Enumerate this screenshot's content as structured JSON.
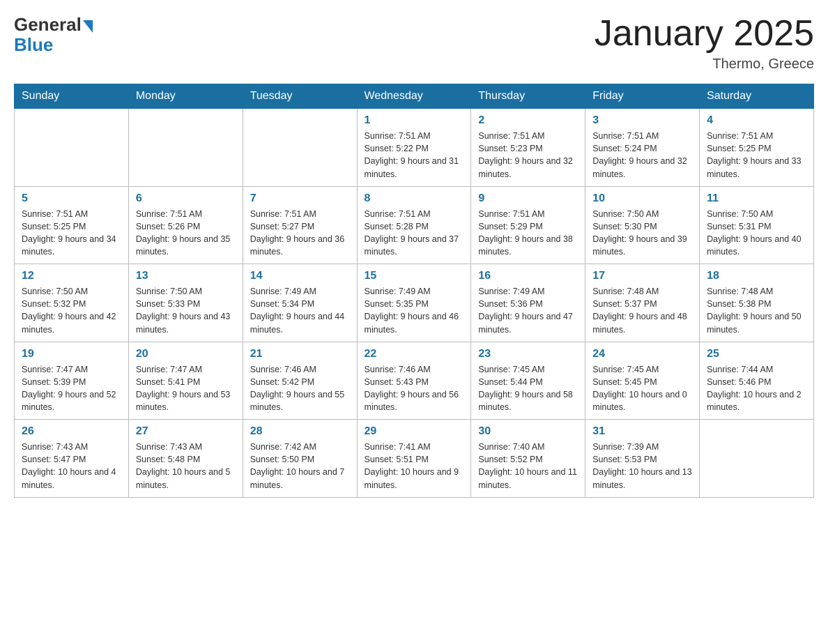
{
  "logo": {
    "general": "General",
    "blue": "Blue"
  },
  "header": {
    "title": "January 2025",
    "location": "Thermo, Greece"
  },
  "weekdays": [
    "Sunday",
    "Monday",
    "Tuesday",
    "Wednesday",
    "Thursday",
    "Friday",
    "Saturday"
  ],
  "weeks": [
    [
      {
        "day": "",
        "sunrise": "",
        "sunset": "",
        "daylight": ""
      },
      {
        "day": "",
        "sunrise": "",
        "sunset": "",
        "daylight": ""
      },
      {
        "day": "",
        "sunrise": "",
        "sunset": "",
        "daylight": ""
      },
      {
        "day": "1",
        "sunrise": "Sunrise: 7:51 AM",
        "sunset": "Sunset: 5:22 PM",
        "daylight": "Daylight: 9 hours and 31 minutes."
      },
      {
        "day": "2",
        "sunrise": "Sunrise: 7:51 AM",
        "sunset": "Sunset: 5:23 PM",
        "daylight": "Daylight: 9 hours and 32 minutes."
      },
      {
        "day": "3",
        "sunrise": "Sunrise: 7:51 AM",
        "sunset": "Sunset: 5:24 PM",
        "daylight": "Daylight: 9 hours and 32 minutes."
      },
      {
        "day": "4",
        "sunrise": "Sunrise: 7:51 AM",
        "sunset": "Sunset: 5:25 PM",
        "daylight": "Daylight: 9 hours and 33 minutes."
      }
    ],
    [
      {
        "day": "5",
        "sunrise": "Sunrise: 7:51 AM",
        "sunset": "Sunset: 5:25 PM",
        "daylight": "Daylight: 9 hours and 34 minutes."
      },
      {
        "day": "6",
        "sunrise": "Sunrise: 7:51 AM",
        "sunset": "Sunset: 5:26 PM",
        "daylight": "Daylight: 9 hours and 35 minutes."
      },
      {
        "day": "7",
        "sunrise": "Sunrise: 7:51 AM",
        "sunset": "Sunset: 5:27 PM",
        "daylight": "Daylight: 9 hours and 36 minutes."
      },
      {
        "day": "8",
        "sunrise": "Sunrise: 7:51 AM",
        "sunset": "Sunset: 5:28 PM",
        "daylight": "Daylight: 9 hours and 37 minutes."
      },
      {
        "day": "9",
        "sunrise": "Sunrise: 7:51 AM",
        "sunset": "Sunset: 5:29 PM",
        "daylight": "Daylight: 9 hours and 38 minutes."
      },
      {
        "day": "10",
        "sunrise": "Sunrise: 7:50 AM",
        "sunset": "Sunset: 5:30 PM",
        "daylight": "Daylight: 9 hours and 39 minutes."
      },
      {
        "day": "11",
        "sunrise": "Sunrise: 7:50 AM",
        "sunset": "Sunset: 5:31 PM",
        "daylight": "Daylight: 9 hours and 40 minutes."
      }
    ],
    [
      {
        "day": "12",
        "sunrise": "Sunrise: 7:50 AM",
        "sunset": "Sunset: 5:32 PM",
        "daylight": "Daylight: 9 hours and 42 minutes."
      },
      {
        "day": "13",
        "sunrise": "Sunrise: 7:50 AM",
        "sunset": "Sunset: 5:33 PM",
        "daylight": "Daylight: 9 hours and 43 minutes."
      },
      {
        "day": "14",
        "sunrise": "Sunrise: 7:49 AM",
        "sunset": "Sunset: 5:34 PM",
        "daylight": "Daylight: 9 hours and 44 minutes."
      },
      {
        "day": "15",
        "sunrise": "Sunrise: 7:49 AM",
        "sunset": "Sunset: 5:35 PM",
        "daylight": "Daylight: 9 hours and 46 minutes."
      },
      {
        "day": "16",
        "sunrise": "Sunrise: 7:49 AM",
        "sunset": "Sunset: 5:36 PM",
        "daylight": "Daylight: 9 hours and 47 minutes."
      },
      {
        "day": "17",
        "sunrise": "Sunrise: 7:48 AM",
        "sunset": "Sunset: 5:37 PM",
        "daylight": "Daylight: 9 hours and 48 minutes."
      },
      {
        "day": "18",
        "sunrise": "Sunrise: 7:48 AM",
        "sunset": "Sunset: 5:38 PM",
        "daylight": "Daylight: 9 hours and 50 minutes."
      }
    ],
    [
      {
        "day": "19",
        "sunrise": "Sunrise: 7:47 AM",
        "sunset": "Sunset: 5:39 PM",
        "daylight": "Daylight: 9 hours and 52 minutes."
      },
      {
        "day": "20",
        "sunrise": "Sunrise: 7:47 AM",
        "sunset": "Sunset: 5:41 PM",
        "daylight": "Daylight: 9 hours and 53 minutes."
      },
      {
        "day": "21",
        "sunrise": "Sunrise: 7:46 AM",
        "sunset": "Sunset: 5:42 PM",
        "daylight": "Daylight: 9 hours and 55 minutes."
      },
      {
        "day": "22",
        "sunrise": "Sunrise: 7:46 AM",
        "sunset": "Sunset: 5:43 PM",
        "daylight": "Daylight: 9 hours and 56 minutes."
      },
      {
        "day": "23",
        "sunrise": "Sunrise: 7:45 AM",
        "sunset": "Sunset: 5:44 PM",
        "daylight": "Daylight: 9 hours and 58 minutes."
      },
      {
        "day": "24",
        "sunrise": "Sunrise: 7:45 AM",
        "sunset": "Sunset: 5:45 PM",
        "daylight": "Daylight: 10 hours and 0 minutes."
      },
      {
        "day": "25",
        "sunrise": "Sunrise: 7:44 AM",
        "sunset": "Sunset: 5:46 PM",
        "daylight": "Daylight: 10 hours and 2 minutes."
      }
    ],
    [
      {
        "day": "26",
        "sunrise": "Sunrise: 7:43 AM",
        "sunset": "Sunset: 5:47 PM",
        "daylight": "Daylight: 10 hours and 4 minutes."
      },
      {
        "day": "27",
        "sunrise": "Sunrise: 7:43 AM",
        "sunset": "Sunset: 5:48 PM",
        "daylight": "Daylight: 10 hours and 5 minutes."
      },
      {
        "day": "28",
        "sunrise": "Sunrise: 7:42 AM",
        "sunset": "Sunset: 5:50 PM",
        "daylight": "Daylight: 10 hours and 7 minutes."
      },
      {
        "day": "29",
        "sunrise": "Sunrise: 7:41 AM",
        "sunset": "Sunset: 5:51 PM",
        "daylight": "Daylight: 10 hours and 9 minutes."
      },
      {
        "day": "30",
        "sunrise": "Sunrise: 7:40 AM",
        "sunset": "Sunset: 5:52 PM",
        "daylight": "Daylight: 10 hours and 11 minutes."
      },
      {
        "day": "31",
        "sunrise": "Sunrise: 7:39 AM",
        "sunset": "Sunset: 5:53 PM",
        "daylight": "Daylight: 10 hours and 13 minutes."
      },
      {
        "day": "",
        "sunrise": "",
        "sunset": "",
        "daylight": ""
      }
    ]
  ]
}
